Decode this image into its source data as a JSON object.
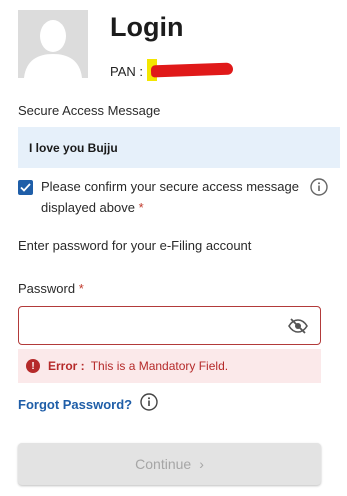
{
  "header": {
    "title": "Login",
    "pan_label": "PAN :"
  },
  "secure_access": {
    "label": "Secure Access Message",
    "message": "I love you Bujju",
    "confirm_text": "Please confirm your secure access message displayed above",
    "required_mark": "*",
    "confirm_checked": true
  },
  "password": {
    "intro": "Enter password for your e-Filing account",
    "label": "Password",
    "required_mark": "*",
    "value": "",
    "error_prefix": "Error :",
    "error_message": "This is a Mandatory Field."
  },
  "links": {
    "forgot_password": "Forgot Password?"
  },
  "actions": {
    "continue_label": "Continue",
    "continue_icon": "chevron-right-icon"
  },
  "colors": {
    "primary": "#1f5ea8",
    "error": "#b52a2a",
    "error_bg": "#fbe9ea",
    "message_bg": "#e6f0fa",
    "disabled_bg": "#e3e3e3"
  }
}
